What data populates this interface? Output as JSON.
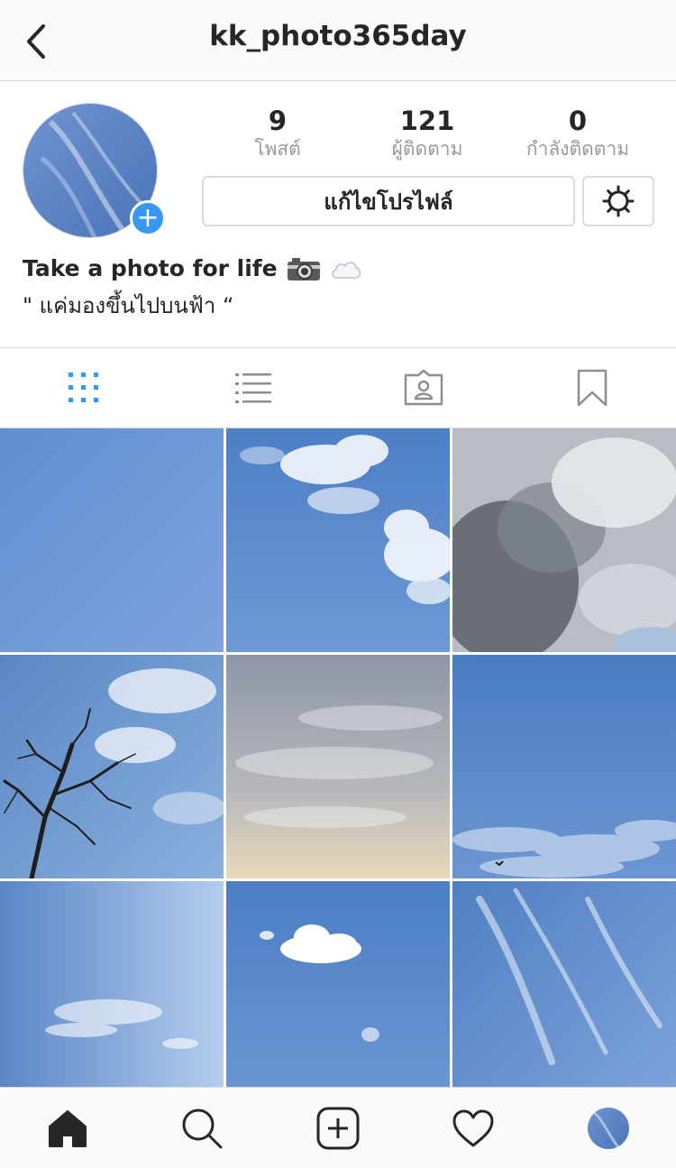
{
  "header": {
    "username": "kk_photo365day",
    "back_icon": "chevron-left-icon"
  },
  "profile": {
    "stats": [
      {
        "value": "9",
        "label": "โพสต์"
      },
      {
        "value": "121",
        "label": "ผู้ติดตาม"
      },
      {
        "value": "0",
        "label": "กำลังติดตาม"
      }
    ],
    "edit_button_label": "แก้ไขโปรไฟล์",
    "settings_icon": "gear-icon",
    "add_icon": "plus-icon",
    "add_symbol": "+"
  },
  "bio": {
    "name": "Take a photo for life",
    "text": "\" แค่มองขึ้นไปบนฟ้า “",
    "emojis": [
      "camera-icon",
      "cloud-icon"
    ]
  },
  "tabs": [
    {
      "name": "grid-view",
      "icon": "grid-icon",
      "active": true
    },
    {
      "name": "list-view",
      "icon": "list-icon",
      "active": false
    },
    {
      "name": "tagged",
      "icon": "tagged-person-icon",
      "active": false
    },
    {
      "name": "saved",
      "icon": "bookmark-icon",
      "active": false
    }
  ],
  "photos": [
    "sky-clear",
    "sky-clouds-right",
    "storm-clouds",
    "tree-branches-sky",
    "hazy-evening-sky",
    "blue-sky-bird",
    "wispy-sky",
    "small-cloud-sky",
    "streaky-clouds-sky"
  ],
  "nav": [
    {
      "name": "home",
      "icon": "home-icon",
      "active": true
    },
    {
      "name": "search",
      "icon": "search-icon",
      "active": false
    },
    {
      "name": "new-post",
      "icon": "add-post-icon",
      "active": false
    },
    {
      "name": "activity",
      "icon": "heart-icon",
      "active": false
    },
    {
      "name": "profile",
      "icon": "profile-avatar",
      "active": false
    }
  ],
  "colors": {
    "accent": "#3897f0",
    "text": "#262626",
    "muted": "#999999",
    "border": "#dbdbdb",
    "bar_bg": "#fafafa"
  }
}
